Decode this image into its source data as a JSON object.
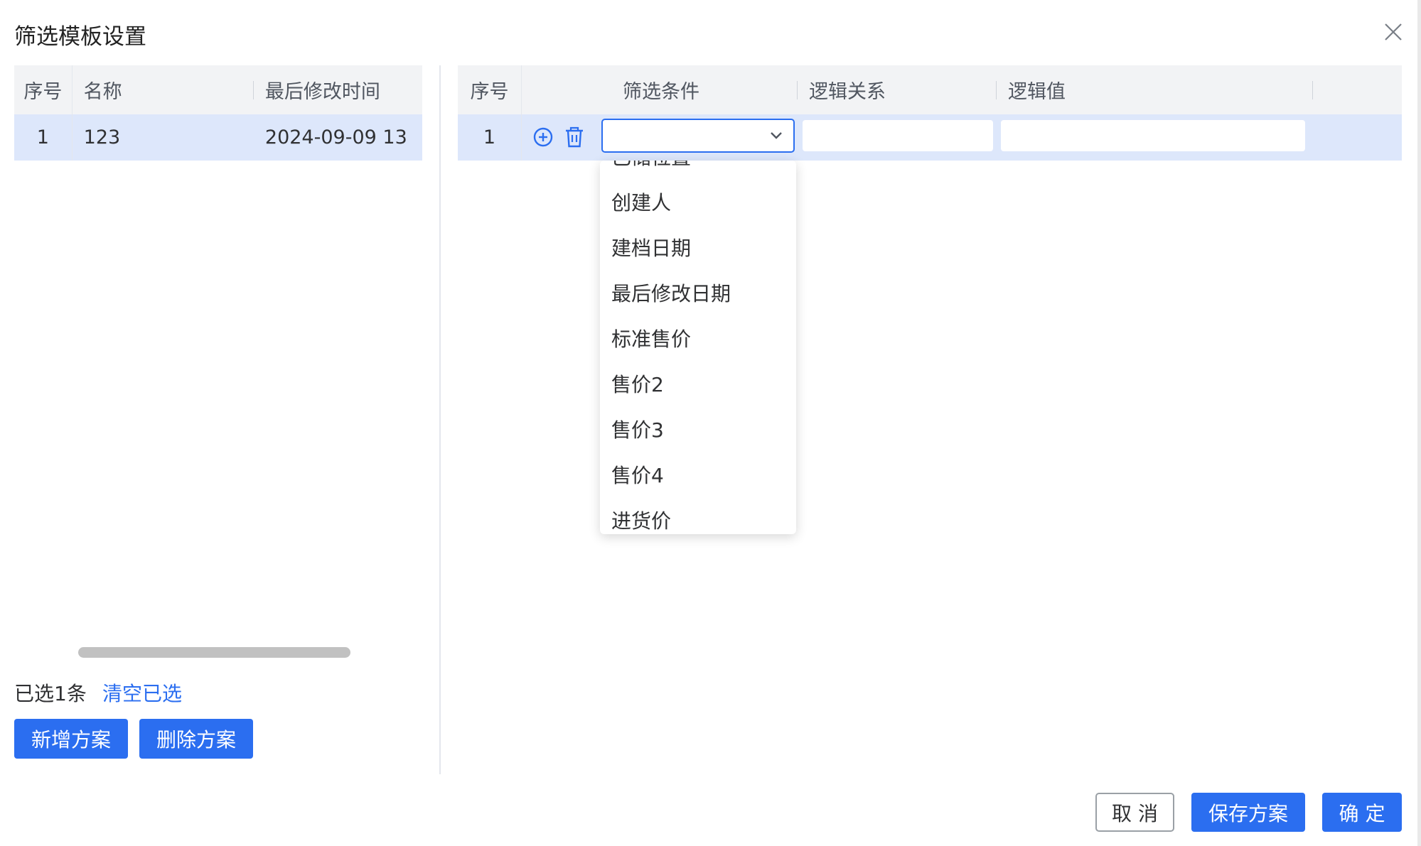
{
  "dialog": {
    "title": "筛选模板设置",
    "close_icon": "close-icon"
  },
  "left": {
    "headers": [
      "序号",
      "名称",
      "最后修改时间"
    ],
    "rows": [
      {
        "index": "1",
        "name": "123",
        "modified": "2024-09-09 13"
      }
    ],
    "selected_info": "已选1条",
    "clear_selection": "清空已选",
    "add_button": "新增方案",
    "delete_button": "删除方案"
  },
  "right": {
    "headers": [
      "序号",
      "筛选条件",
      "逻辑关系",
      "逻辑值"
    ],
    "rows": [
      {
        "index": "1",
        "condition": "",
        "relation": "",
        "value": ""
      }
    ],
    "icons": {
      "add": "plus-circle-icon",
      "delete": "trash-icon",
      "select": "chevron-down-icon"
    }
  },
  "dropdown": {
    "options": [
      "已储位置",
      "创建人",
      "建档日期",
      "最后修改日期",
      "标准售价",
      "售价2",
      "售价3",
      "售价4",
      "进货价"
    ]
  },
  "footer": {
    "cancel": "取 消",
    "save": "保存方案",
    "ok": "确 定"
  },
  "colors": {
    "primary": "#2b6ef0",
    "selected_row": "#dde7fb",
    "header_bg": "#f2f3f5"
  }
}
